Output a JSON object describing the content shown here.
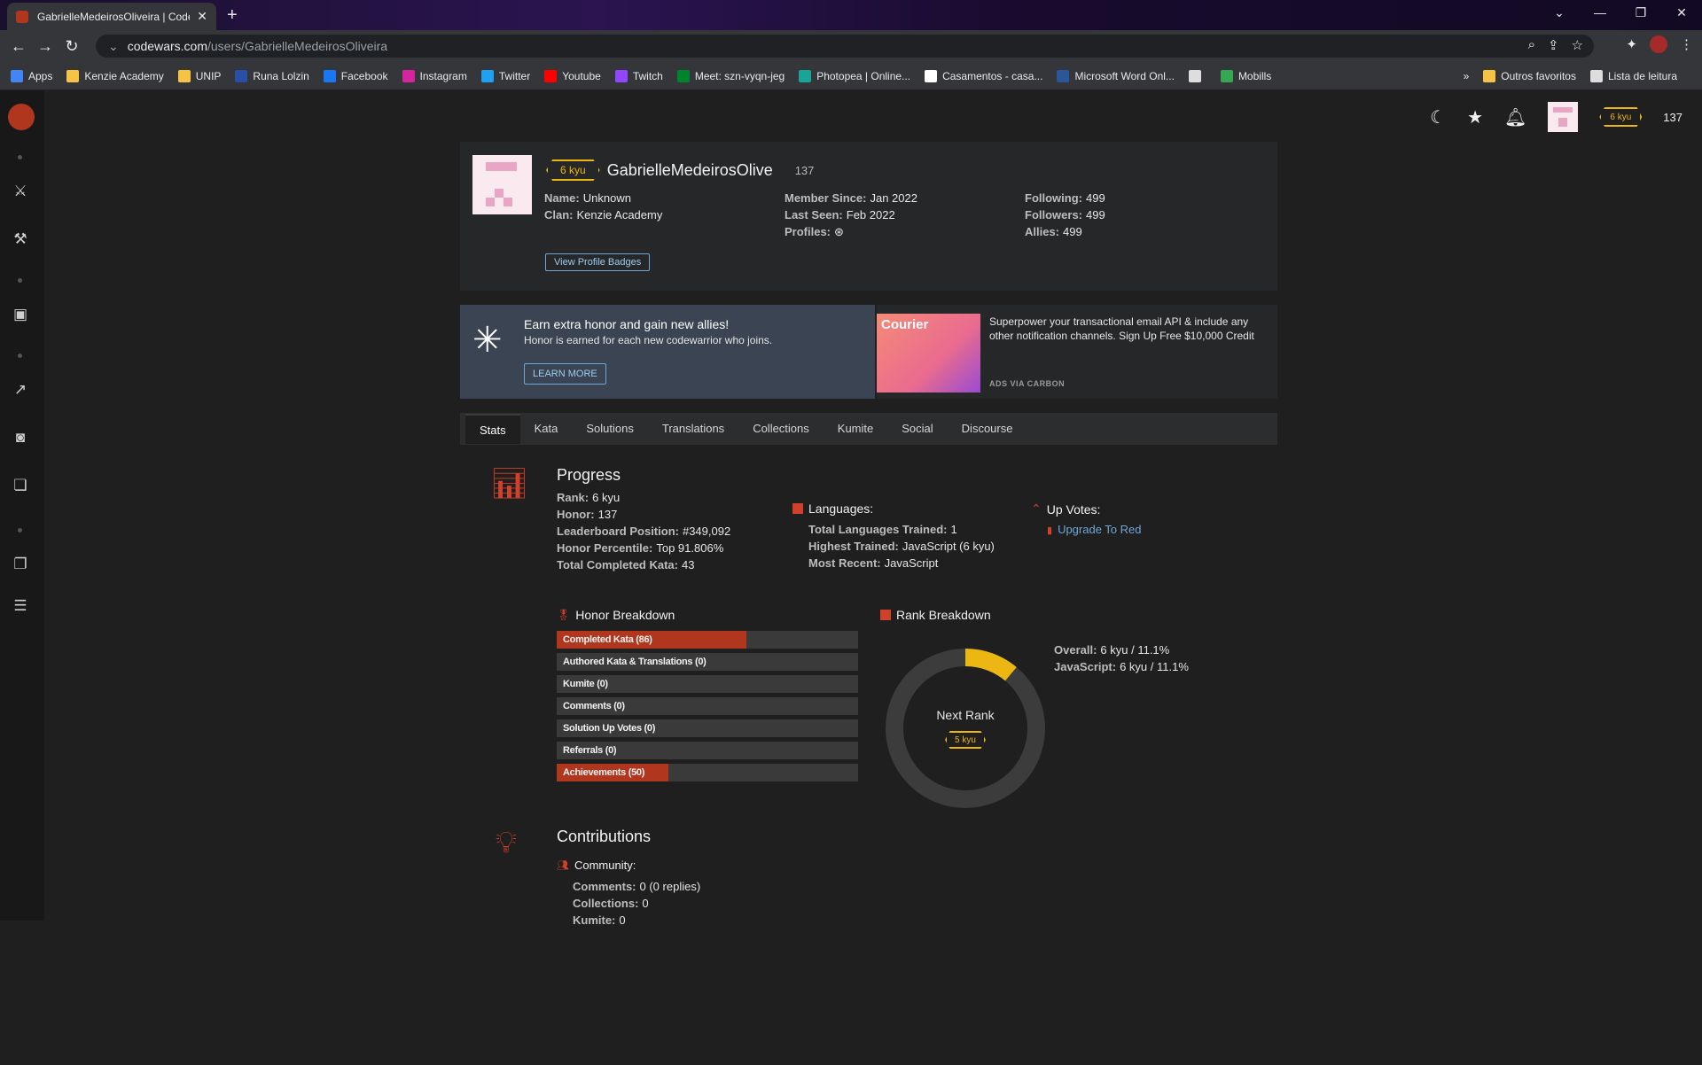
{
  "browser": {
    "tab_title": "GabrielleMedeirosOliveira | Code",
    "url_host": "codewars.com",
    "url_path": "/users/GabrielleMedeirosOliveira",
    "bookmarks": [
      {
        "label": "Apps",
        "color": "#4285f4"
      },
      {
        "label": "Kenzie Academy",
        "color": "#f6c343"
      },
      {
        "label": "UNIP",
        "color": "#f6c343"
      },
      {
        "label": "Runa Lolzin",
        "color": "#2b4fa8"
      },
      {
        "label": "Facebook",
        "color": "#1877f2"
      },
      {
        "label": "Instagram",
        "color": "#d6249f"
      },
      {
        "label": "Twitter",
        "color": "#1da1f2"
      },
      {
        "label": "Youtube",
        "color": "#ff0000"
      },
      {
        "label": "Twitch",
        "color": "#9146ff"
      },
      {
        "label": "Meet: szn-vyqn-jeg",
        "color": "#00832d"
      },
      {
        "label": "Photopea | Online...",
        "color": "#18a497"
      },
      {
        "label": "Casamentos - casa...",
        "color": "#ffffff"
      },
      {
        "label": "Microsoft Word Onl...",
        "color": "#2b579a"
      },
      {
        "label": "",
        "color": "#dddddd"
      },
      {
        "label": "Mobills",
        "color": "#34a853"
      }
    ],
    "bookmarks_right": {
      "more": "»",
      "others": "Outros favoritos",
      "reading": "Lista de leitura"
    }
  },
  "topnav": {
    "rank": "6 kyu",
    "honor": "137"
  },
  "profile": {
    "rank": "6 kyu",
    "username": "GabrielleMedeirosOliveira",
    "honor": "137",
    "name_label": "Name:",
    "name": "Unknown",
    "clan_label": "Clan:",
    "clan": "Kenzie Academy",
    "member_label": "Member Since:",
    "member_since": "Jan 2022",
    "seen_label": "Last Seen:",
    "last_seen": "Feb 2022",
    "profiles_label": "Profiles:",
    "following_label": "Following:",
    "following": "499",
    "followers_label": "Followers:",
    "followers": "499",
    "allies_label": "Allies:",
    "allies": "499",
    "badges_button": "View Profile Badges"
  },
  "promo": {
    "title": "Earn extra honor and gain new allies!",
    "subtitle": "Honor is earned for each new codewarrior who joins.",
    "button": "LEARN MORE"
  },
  "ad": {
    "brand": "Courier",
    "text": "Superpower your transactional email API & include any other notification channels. Sign Up Free $10,000 Credit",
    "via": "ADS VIA CARBON"
  },
  "tabs": [
    "Stats",
    "Kata",
    "Solutions",
    "Translations",
    "Collections",
    "Kumite",
    "Social",
    "Discourse"
  ],
  "progress": {
    "title": "Progress",
    "rank_label": "Rank:",
    "rank": "6 kyu",
    "honor_label": "Honor:",
    "honor": "137",
    "leader_label": "Leaderboard Position:",
    "leader": "#349,092",
    "percentile_label": "Honor Percentile:",
    "percentile": "Top 91.806%",
    "completed_label": "Total Completed Kata:",
    "completed": "43"
  },
  "languages": {
    "title": "Languages:",
    "trained_label": "Total Languages Trained:",
    "trained": "1",
    "highest_label": "Highest Trained:",
    "highest": "JavaScript (6 kyu)",
    "recent_label": "Most Recent:",
    "recent": "JavaScript"
  },
  "upvotes": {
    "title": "Up Votes:",
    "link": "Upgrade To Red"
  },
  "honor_breakdown": {
    "title": "Honor Breakdown",
    "items": [
      {
        "label": "Completed Kata (86)",
        "fill": 0.63
      },
      {
        "label": "Authored Kata & Translations (0)",
        "fill": 0
      },
      {
        "label": "Kumite (0)",
        "fill": 0
      },
      {
        "label": "Comments (0)",
        "fill": 0
      },
      {
        "label": "Solution Up Votes (0)",
        "fill": 0
      },
      {
        "label": "Referrals (0)",
        "fill": 0
      },
      {
        "label": "Achievements (50)",
        "fill": 0.37
      }
    ]
  },
  "rank_breakdown": {
    "title": "Rank Breakdown",
    "next_rank_label": "Next Rank",
    "next_rank": "5 kyu",
    "progress": 0.111,
    "overall_label": "Overall:",
    "overall": "6 kyu / 11.1%",
    "js_label": "JavaScript:",
    "js": "6 kyu / 11.1%"
  },
  "contributions": {
    "title": "Contributions",
    "community": "Community:",
    "comments_label": "Comments:",
    "comments": "0 (0 replies)",
    "collections_label": "Collections:",
    "collections": "0",
    "kumite_label": "Kumite:",
    "kumite": "0"
  }
}
